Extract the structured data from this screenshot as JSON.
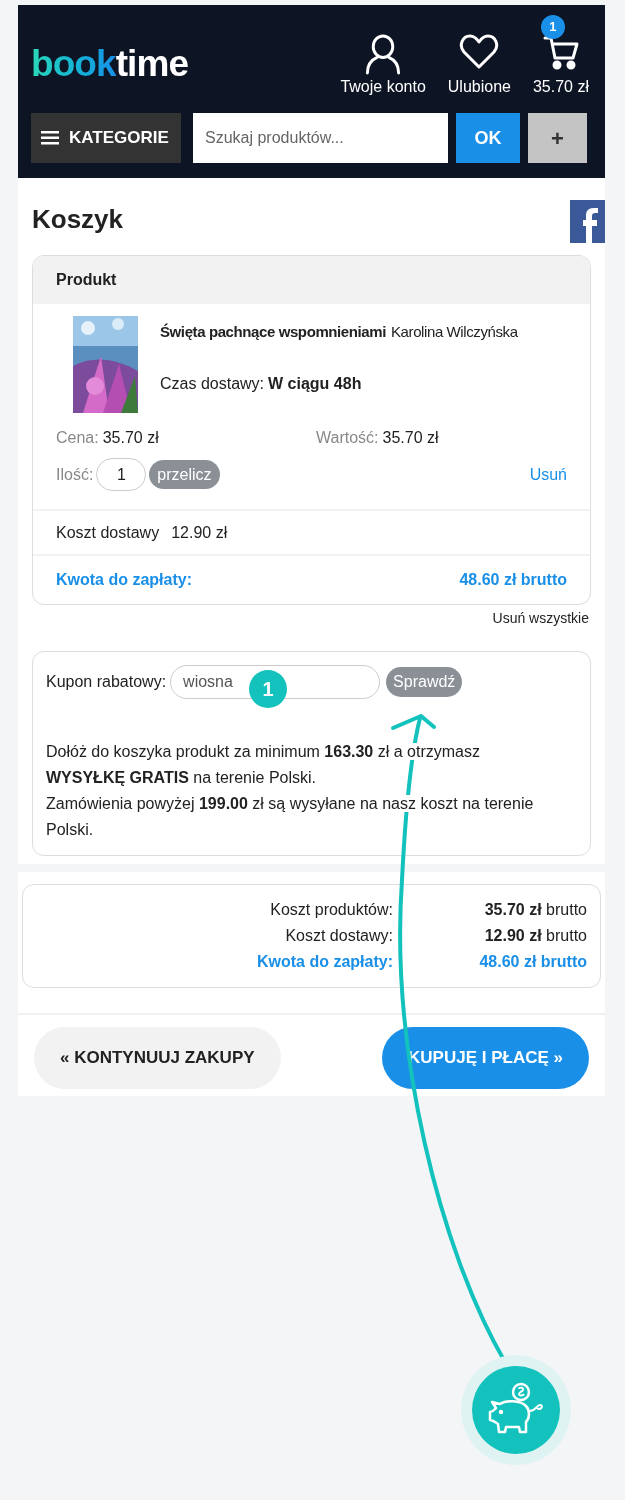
{
  "header": {
    "logo": {
      "part_1": "book",
      "part_2": "time"
    },
    "nav": [
      {
        "kind": "account",
        "label": "Twoje konto"
      },
      {
        "kind": "favorites",
        "label": "Ulubione"
      },
      {
        "kind": "cart",
        "label": "35.70 zł",
        "badge": "1"
      }
    ],
    "categories_button": "KATEGORIE",
    "search": {
      "placeholder": "Szukaj produktów..."
    },
    "search_button": "OK",
    "plus_button": "+"
  },
  "page_title": "Koszyk",
  "cart": {
    "column": "Produkt",
    "items": [
      {
        "title": "Święta pachnące wspomnieniami",
        "author": "Karolina Wilczyńska",
        "delivery_label": "Czas dostawy:",
        "delivery_value": "W ciągu 48h",
        "price_label": "Cena:",
        "price": "35.70 zł",
        "value_label": "Wartość:",
        "value": "35.70 zł",
        "qty_label": "Ilość:",
        "qty": "1",
        "recalc": "przelicz",
        "remove": "Usuń"
      }
    ],
    "shipping_label": "Koszt dostawy",
    "shipping_value": "12.90 zł",
    "total_label": "Kwota do zapłaty:",
    "total_value": "48.60 zł brutto"
  },
  "remove_all": "Usuń wszystkie",
  "coupon": {
    "label": "Kupon rabatowy:",
    "value": "wiosna",
    "check_button": "Sprawdź",
    "notes": [
      "Dołóż do koszyka produkt za minimum **163.30** zł a otrzymasz **WYSYŁKĘ GRATIS** na terenie Polski.",
      "Zamówienia powyżej **199.00** zł są wysyłane na nasz koszt na terenie Polski."
    ]
  },
  "summary": [
    {
      "label": "Koszt produktów:",
      "value": "**35.70 zł** brutto",
      "highlight": false
    },
    {
      "label": "Koszt dostawy:",
      "value": "**12.90 zł** brutto",
      "highlight": false
    },
    {
      "label": "Kwota do zapłaty:",
      "value": "48.60 zł brutto",
      "highlight": true
    }
  ],
  "continue_button": "« KONTYNUUJ ZAKUPY",
  "checkout_button": "KUPUJĘ I PŁACĘ »",
  "annotation": {
    "step": "1"
  }
}
